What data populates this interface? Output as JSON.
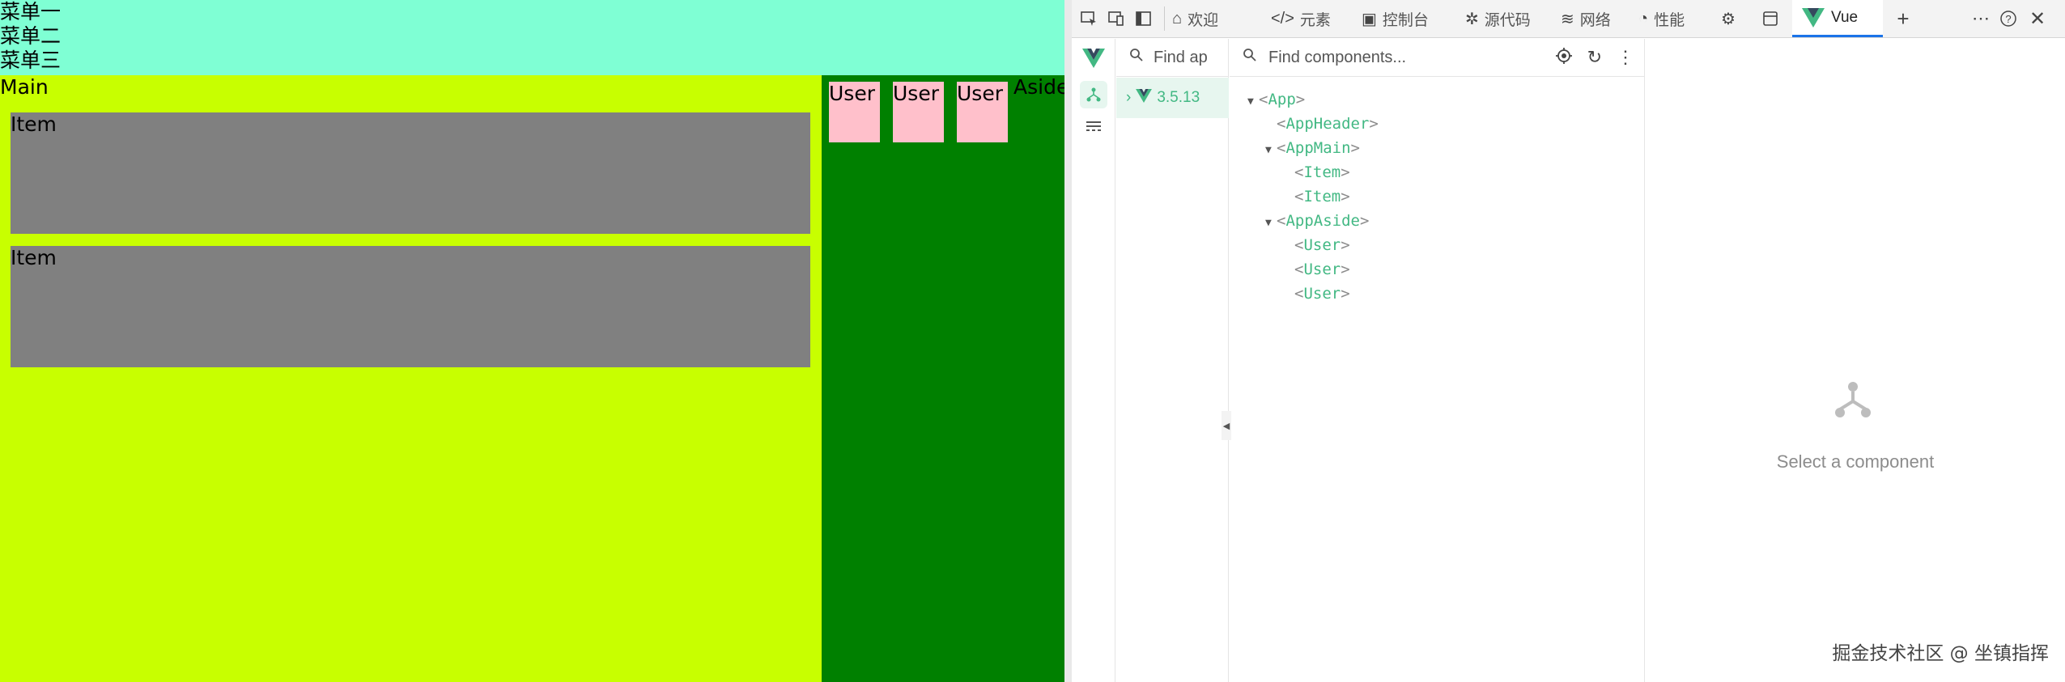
{
  "app": {
    "header": {
      "menu_items": [
        "菜单一",
        "菜单二",
        "菜单三"
      ]
    },
    "main": {
      "label": "Main",
      "items": [
        {
          "label": "Item"
        },
        {
          "label": "Item"
        }
      ]
    },
    "aside": {
      "label": "Aside",
      "users": [
        {
          "label": "User"
        },
        {
          "label": "User"
        },
        {
          "label": "User"
        }
      ]
    },
    "colors": {
      "header_bg": "#7fffd4",
      "main_bg": "#c8ff00",
      "aside_bg": "#008000",
      "item_bg": "#808080",
      "user_bg": "#ffc0cb"
    }
  },
  "devtools": {
    "tabs": [
      {
        "icon": "home-icon",
        "label": "欢迎"
      },
      {
        "icon": "code-icon",
        "label": "元素"
      },
      {
        "icon": "console-icon",
        "label": "控制台"
      },
      {
        "icon": "bug-icon",
        "label": "源代码"
      },
      {
        "icon": "wifi-icon",
        "label": "网络"
      },
      {
        "icon": "gauge-icon",
        "label": "性能"
      },
      {
        "icon": "vue-icon",
        "label": "Vue",
        "active": true
      }
    ],
    "vue": {
      "apps_search_placeholder": "Find apps...",
      "apps_search_visible": "Find ap",
      "app_version": "3.5.13",
      "components_search_placeholder": "Find components...",
      "tree": [
        {
          "name": "App",
          "expanded": true,
          "depth": 0
        },
        {
          "name": "AppHeader",
          "expanded": false,
          "depth": 1
        },
        {
          "name": "AppMain",
          "expanded": true,
          "depth": 1
        },
        {
          "name": "Item",
          "expanded": false,
          "depth": 2
        },
        {
          "name": "Item",
          "expanded": false,
          "depth": 2
        },
        {
          "name": "AppAside",
          "expanded": true,
          "depth": 1
        },
        {
          "name": "User",
          "expanded": false,
          "depth": 2
        },
        {
          "name": "User",
          "expanded": false,
          "depth": 2
        },
        {
          "name": "User",
          "expanded": false,
          "depth": 2
        }
      ],
      "empty_state": "Select a component",
      "accent": "#42b883"
    }
  },
  "watermark": "掘金技术社区 @ 坐镇指挥"
}
